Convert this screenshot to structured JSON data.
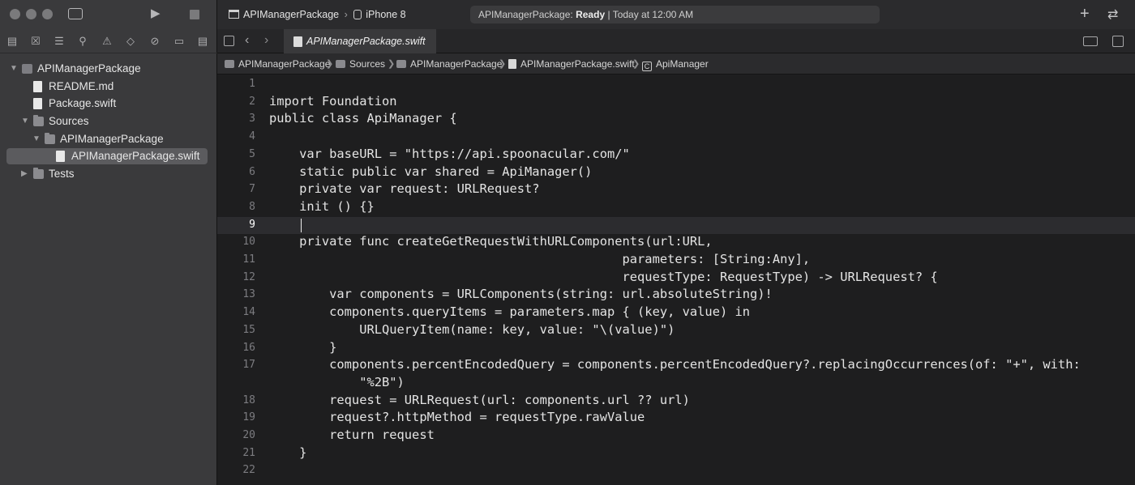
{
  "window": {
    "scheme": "APIManagerPackage",
    "destination": "iPhone 8",
    "status_name": "APIManagerPackage:",
    "status_state": "Ready",
    "status_time": "| Today at 12:00 AM"
  },
  "tab": {
    "title": "APIManagerPackage.swift"
  },
  "jumpbar": {
    "crumbs": [
      "APIManagerPackage",
      "Sources",
      "APIManagerPackage",
      "APIManagerPackage.swift",
      "ApiManager"
    ]
  },
  "navigator": {
    "items": [
      {
        "label": "APIManagerPackage",
        "kind": "package",
        "level": 0,
        "expanded": true
      },
      {
        "label": "README.md",
        "kind": "file",
        "level": 1
      },
      {
        "label": "Package.swift",
        "kind": "file",
        "level": 1
      },
      {
        "label": "Sources",
        "kind": "folder",
        "level": 1,
        "expanded": true
      },
      {
        "label": "APIManagerPackage",
        "kind": "folder",
        "level": 2,
        "expanded": true
      },
      {
        "label": "APIManagerPackage.swift",
        "kind": "file",
        "level": 3,
        "selected": true
      },
      {
        "label": "Tests",
        "kind": "folder",
        "level": 1,
        "expanded": false
      }
    ]
  },
  "editor": {
    "active_line": 9,
    "lines": [
      {
        "num": "1",
        "text": ""
      },
      {
        "num": "2",
        "text": "import Foundation"
      },
      {
        "num": "3",
        "text": "public class ApiManager {"
      },
      {
        "num": "4",
        "text": ""
      },
      {
        "num": "5",
        "text": "    var baseURL = \"https://api.spoonacular.com/\""
      },
      {
        "num": "6",
        "text": "    static public var shared = ApiManager()"
      },
      {
        "num": "7",
        "text": "    private var request: URLRequest?"
      },
      {
        "num": "8",
        "text": "    init () {}"
      },
      {
        "num": "9",
        "text": ""
      },
      {
        "num": "10",
        "text": "    private func createGetRequestWithURLComponents(url:URL,"
      },
      {
        "num": "11",
        "text": "                                               parameters: [String:Any],"
      },
      {
        "num": "12",
        "text": "                                               requestType: RequestType) -> URLRequest? {"
      },
      {
        "num": "13",
        "text": "        var components = URLComponents(string: url.absoluteString)!"
      },
      {
        "num": "14",
        "text": "        components.queryItems = parameters.map { (key, value) in"
      },
      {
        "num": "15",
        "text": "            URLQueryItem(name: key, value: \"\\(value)\")"
      },
      {
        "num": "16",
        "text": "        }"
      },
      {
        "num": "17",
        "text": "        components.percentEncodedQuery = components.percentEncodedQuery?.replacingOccurrences(of: \"+\", with:"
      },
      {
        "num": "",
        "text": "            \"%2B\")"
      },
      {
        "num": "18",
        "text": "        request = URLRequest(url: components.url ?? url)"
      },
      {
        "num": "19",
        "text": "        request?.httpMethod = requestType.rawValue"
      },
      {
        "num": "20",
        "text": "        return request"
      },
      {
        "num": "21",
        "text": "    }"
      },
      {
        "num": "22",
        "text": ""
      }
    ]
  }
}
